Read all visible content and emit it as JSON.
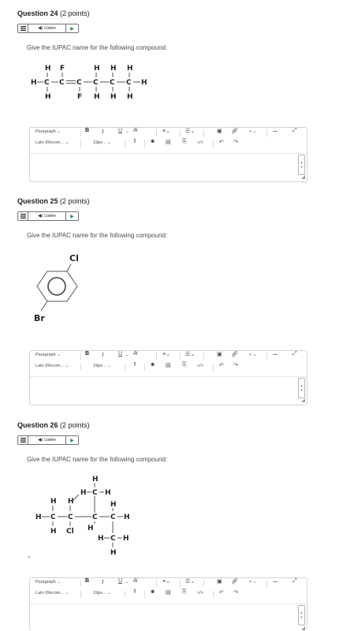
{
  "questions": [
    {
      "title": "Question 24",
      "points": "(2 points)",
      "listen_label": "Listen",
      "prompt": "Give the IUPAC name for the following compound:"
    },
    {
      "title": "Question 25",
      "points": "(2 points)",
      "listen_label": "Listen",
      "prompt": "Give the IUPAC name for the following compound:",
      "substituents": [
        "Cl",
        "Br"
      ]
    },
    {
      "title": "Question 26",
      "points": "(2 points)",
      "listen_label": "Listen",
      "prompt": "Give the IUPAC name for the following compound:"
    }
  ],
  "editor": {
    "paragraph_label": "Paragraph",
    "font_label": "Lato (Recom...",
    "size_label": "19px...",
    "bold": "B",
    "italic": "I",
    "underline": "U",
    "more": "...",
    "plus": "+"
  },
  "molecules": {
    "q24": {
      "top_row": [
        "H",
        "F",
        "H",
        "H",
        "H"
      ],
      "main_row": [
        "H",
        "C",
        "C",
        "C",
        "C",
        "C",
        "C",
        "H"
      ],
      "bottom_row": [
        "H",
        "F",
        "H",
        "H",
        "H"
      ]
    },
    "q26": {
      "atoms": [
        "H",
        "H",
        "C",
        "H",
        "H",
        "H",
        "H",
        "C",
        "C",
        "C",
        "C",
        "H",
        "H",
        "Cl",
        "H",
        "H",
        "C",
        "H",
        "H"
      ]
    }
  }
}
